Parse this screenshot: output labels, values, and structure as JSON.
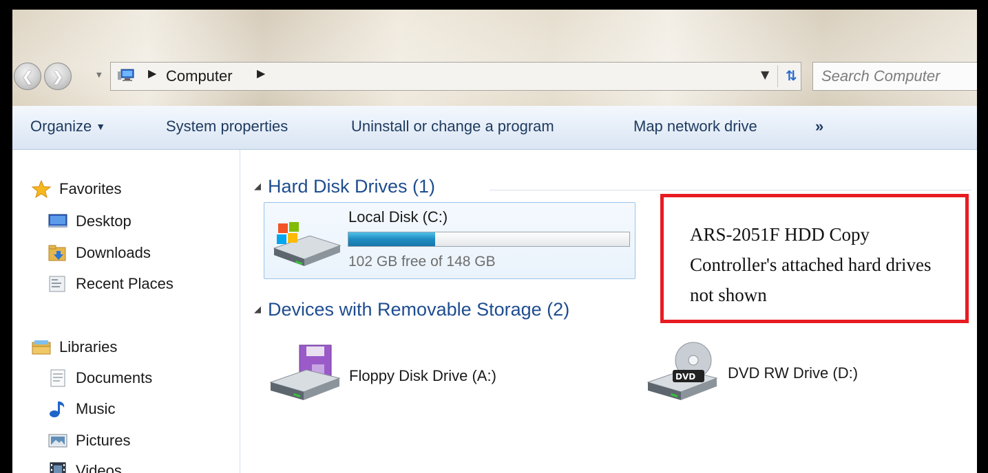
{
  "address_bar": {
    "location": "Computer",
    "search_placeholder": "Search Computer"
  },
  "command_bar": {
    "organize": "Organize",
    "system_properties": "System properties",
    "uninstall": "Uninstall or change a program",
    "map_network_drive": "Map network drive",
    "more": "»"
  },
  "nav_pane": {
    "favorites": "Favorites",
    "favorite_items": [
      "Desktop",
      "Downloads",
      "Recent Places"
    ],
    "libraries": "Libraries",
    "library_items": [
      "Documents",
      "Music",
      "Pictures",
      "Videos"
    ]
  },
  "hard_disk_group": {
    "title": "Hard Disk Drives (1)",
    "drive": {
      "name": "Local Disk (C:)",
      "free_text": "102 GB free of 148 GB",
      "used_fraction": 0.31
    }
  },
  "removable_group": {
    "title": "Devices with Removable Storage (2)",
    "floppy": "Floppy Disk Drive (A:)",
    "dvd": "DVD RW Drive (D:)",
    "dvd_badge": "DVD"
  },
  "annotation": {
    "text": "ARS-2051F HDD Copy Controller's attached hard drives not shown",
    "border_color": "#e81b22"
  }
}
